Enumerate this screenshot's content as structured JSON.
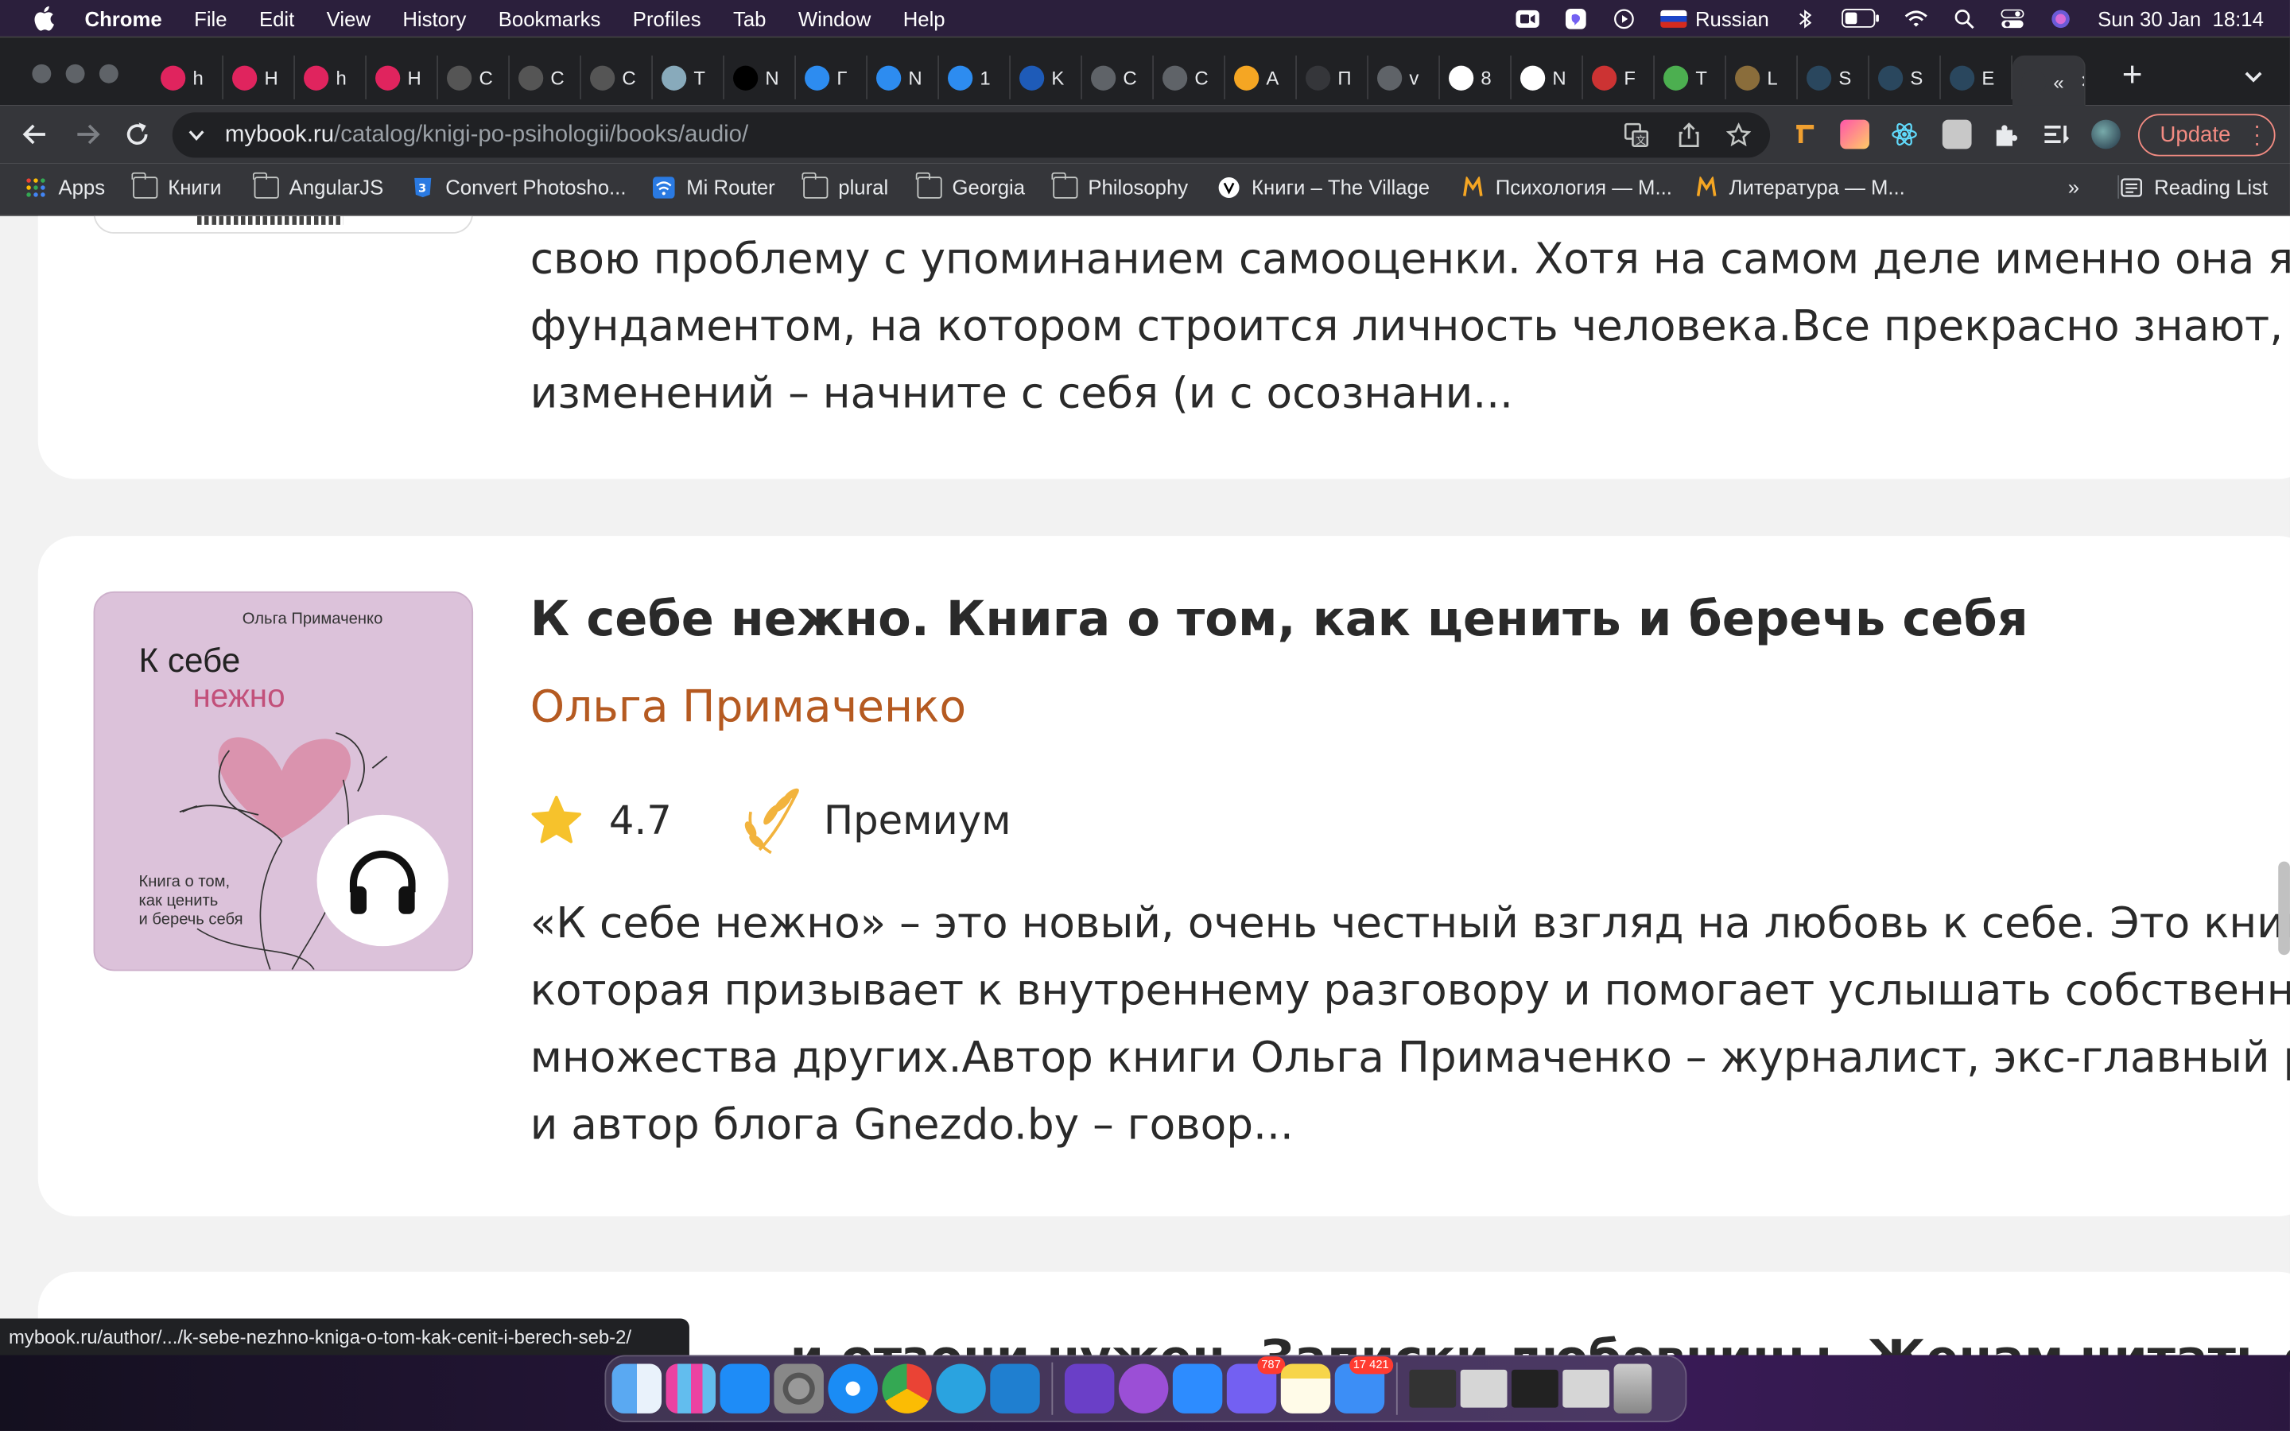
{
  "menubar": {
    "app": "Chrome",
    "items": [
      "File",
      "Edit",
      "View",
      "History",
      "Bookmarks",
      "Profiles",
      "Tab",
      "Window",
      "Help"
    ],
    "input_language": "Russian",
    "datetime": "Sun 30 Jan  18:14"
  },
  "tabs": [
    {
      "letter": "h",
      "icon": "youtube-music-icon"
    },
    {
      "letter": "H",
      "icon": "youtube-music-icon"
    },
    {
      "letter": "h",
      "icon": "youtube-music-icon"
    },
    {
      "letter": "H",
      "icon": "youtube-music-icon"
    },
    {
      "letter": "C",
      "icon": "hd-icon"
    },
    {
      "letter": "C",
      "icon": "hd-icon"
    },
    {
      "letter": "C",
      "icon": "hd-icon"
    },
    {
      "letter": "T",
      "icon": "ship-icon"
    },
    {
      "letter": "N",
      "icon": "netflix-icon"
    },
    {
      "letter": "Г",
      "icon": "book-icon"
    },
    {
      "letter": "N",
      "icon": "book-icon"
    },
    {
      "letter": "1",
      "icon": "book-icon"
    },
    {
      "letter": "K",
      "icon": "trident-icon"
    },
    {
      "letter": "C",
      "icon": "globe-icon"
    },
    {
      "letter": "C",
      "icon": "globe-icon"
    },
    {
      "letter": "A",
      "icon": "mybook-icon"
    },
    {
      "letter": "П",
      "icon": "speaker-icon"
    },
    {
      "letter": "v",
      "icon": "globe-icon"
    },
    {
      "letter": "8",
      "icon": "google-icon"
    },
    {
      "letter": "N",
      "icon": "google-icon"
    },
    {
      "letter": "F",
      "icon": "books-icon"
    },
    {
      "letter": "T",
      "icon": "star-icon"
    },
    {
      "letter": "L",
      "icon": "hex-icon"
    },
    {
      "letter": "S",
      "icon": "steam-icon"
    },
    {
      "letter": "S",
      "icon": "steam-icon"
    },
    {
      "letter": "E",
      "icon": "steam-icon"
    },
    {
      "letter": "«",
      "icon": "quote-icon"
    }
  ],
  "toolbar": {
    "url_domain": "mybook.ru",
    "url_path": "/catalog/knigi-po-psihologii/books/audio/",
    "update_label": "Update"
  },
  "bookmarks": {
    "items": [
      {
        "label": "Apps",
        "icon": "apps-grid-icon"
      },
      {
        "label": "Книги",
        "icon": "folder-icon"
      },
      {
        "label": "AngularJS",
        "icon": "folder-icon"
      },
      {
        "label": "Convert Photosho...",
        "icon": "css-icon"
      },
      {
        "label": "Mi Router",
        "icon": "wifi-icon"
      },
      {
        "label": "plural",
        "icon": "folder-icon"
      },
      {
        "label": "Georgia",
        "icon": "folder-icon"
      },
      {
        "label": "Philosophy",
        "icon": "folder-icon"
      },
      {
        "label": "Книги – The Village",
        "icon": "village-icon"
      },
      {
        "label": "Психология — M...",
        "icon": "mybook-icon"
      },
      {
        "label": "Литература — M...",
        "icon": "mybook-icon"
      }
    ],
    "overflow": "»",
    "reading_list": "Reading List"
  },
  "prev_card": {
    "lines": [
      "свою проблему с упоминанием самооценки. Хотя на самом деле именно она я",
      "фундаментом, на котором строится личность человека.Все прекрасно знают, ч",
      "изменений – начните с себя (и с осознани..."
    ]
  },
  "book": {
    "cover_author": "Ольга Примаченко",
    "cover_title_1": "К себе",
    "cover_title_2": "нежно",
    "cover_subtitle": "Книга о том,\nкак ценить\nи беречь себя",
    "title": "К себе нежно. Книга о том, как ценить и беречь себя",
    "author": "Ольга Примаченко",
    "rating": "4.7",
    "tier": "Премиум",
    "description": [
      "«К себе нежно» – это новый, очень честный взгляд на любовь к себе. Это книг",
      "которая призывает к внутреннему разговору и помогает услышать собственн",
      "множества других.Автор книги Ольга Примаченко – журналист, экс-главный р",
      "и автор блога Gnezdo.by – говор..."
    ]
  },
  "next_card": {
    "partial_title": "…и отзони нужен. Записки любовницы. Женам читать обяз"
  },
  "status_bar": {
    "url": "mybook.ru/author/.../k-sebe-nezhno-kniga-o-tom-kak-cenit-i-berech-seb-2/"
  },
  "dock": {
    "apps": [
      "finder-icon",
      "launchpad-icon",
      "app-store-icon",
      "system-preferences-icon",
      "safari-icon",
      "chrome-icon",
      "telegram-icon",
      "vscode-icon",
      "imovie-icon",
      "podcasts-icon",
      "zoom-icon",
      "viber-icon",
      "notes-icon",
      "mail-icon"
    ],
    "viber_badge": "787",
    "mail_badge": "17 421"
  },
  "colors": {
    "menubar": "#2b1f3c",
    "tabstrip": "#202124",
    "toolbar": "#35363a",
    "author_link": "#b55a21",
    "update_outline": "#f28b82",
    "cover_bg": "#dcc2da"
  }
}
